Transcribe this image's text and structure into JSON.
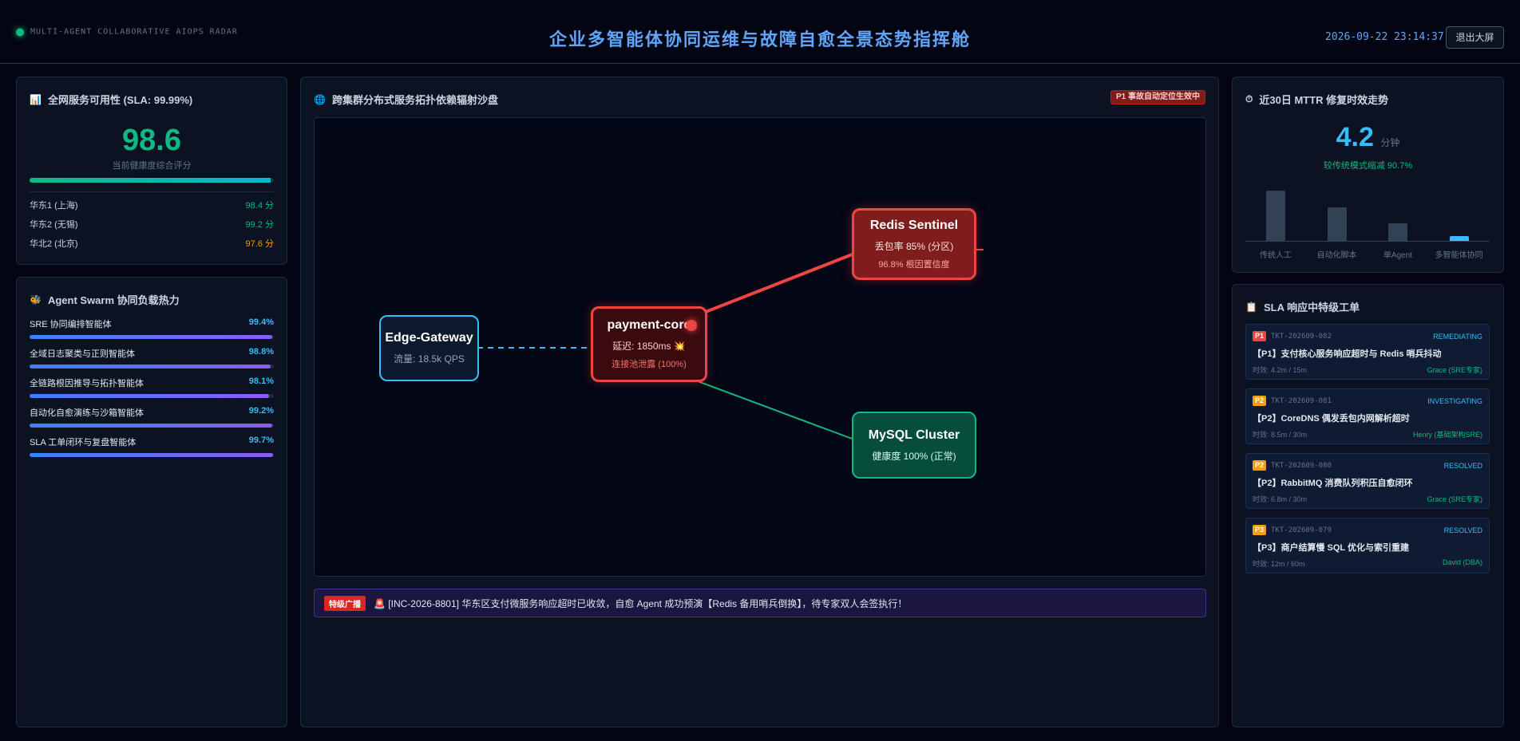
{
  "header": {
    "brand": "MULTI-AGENT COLLABORATIVE AIOPS RADAR",
    "title": "企业多智能体协同运维与故障自愈全景态势指挥舱",
    "datetime": "2026-09-22 23:14:37",
    "exit_label": "退出大屏"
  },
  "colors": {
    "accent": "#60a5fa",
    "healthy": "#10b981",
    "critical": "#ef4444",
    "warning": "#f59e0b",
    "background": "#030612"
  },
  "health": {
    "icon": "chart-icon",
    "title": "全网服务可用性 (SLA: 99.99%)",
    "score": "98.6",
    "score_label": "当前健康度综合评分",
    "progress": 0.986,
    "regions": [
      {
        "name": "华东1 (上海)",
        "value": "98.4 分",
        "color": "#10b981"
      },
      {
        "name": "华东2 (无锡)",
        "value": "99.2 分",
        "color": "#10b981"
      },
      {
        "name": "华北2 (北京)",
        "value": "97.6 分",
        "color": "#f59e0b"
      }
    ]
  },
  "agents": {
    "icon": "swarm-icon",
    "title": "Agent Swarm 协同负载热力",
    "items": [
      {
        "name": "SRE 协同编排智能体",
        "value": "99.4%",
        "fill": 0.994
      },
      {
        "name": "全域日志聚类与正则智能体",
        "value": "98.8%",
        "fill": 0.988
      },
      {
        "name": "全链路根因推导与拓扑智能体",
        "value": "98.1%",
        "fill": 0.981
      },
      {
        "name": "自动化自愈演练与沙箱智能体",
        "value": "99.2%",
        "fill": 0.992
      },
      {
        "name": "SLA 工单闭环与复盘智能体",
        "value": "99.7%",
        "fill": 0.997
      }
    ]
  },
  "topology": {
    "icon": "globe-icon",
    "title": "跨集群分布式服务拓扑依赖辐射沙盘",
    "badge": "P1 事故自动定位生效中",
    "nodes": {
      "gateway": {
        "name": "Edge-Gateway",
        "line1": "流量: 18.5k QPS"
      },
      "payment": {
        "name": "payment-core",
        "line1": "延迟: 1850ms 💥",
        "line2": "连接池泄露 (100%)"
      },
      "redis": {
        "name": "Redis Sentinel",
        "line1": "丢包率 85% (分区)",
        "line2": "96.8% 根因置信度"
      },
      "mysql": {
        "name": "MySQL Cluster",
        "line1": "健康度 100% (正常)"
      }
    },
    "broadcast": {
      "tag": "特级广播",
      "text": "🚨 [INC-2026-8801] 华东区支付微服务响应超时已收敛，自愈 Agent 成功预演【Redis 备用哨兵倒换】，待专家双人会签执行！"
    }
  },
  "mttr": {
    "icon": "stopwatch-icon",
    "title": "近30日 MTTR 修复时效走势",
    "value": "4.2",
    "unit": "分钟",
    "subtitle": "较传统模式缩减 90.7%",
    "chart_data": {
      "type": "bar",
      "categories": [
        "传统人工",
        "自动化脚本",
        "单Agent",
        "多智能体协同"
      ],
      "values": [
        45,
        30,
        16,
        4.2
      ],
      "ylim": [
        0,
        50
      ],
      "highlight_index": 3
    }
  },
  "tickets": {
    "icon": "clipboard-icon",
    "title": "SLA 响应中特级工单",
    "items": [
      {
        "priority": "P1",
        "color": "#ef4444",
        "id": "TKT-202609-082",
        "status": "REMEDIATING",
        "title": "【P1】支付核心服务响应超时与 Redis 哨兵抖动",
        "sla": "时效: 4.2m / 15m",
        "owner": "Grace (SRE专家)"
      },
      {
        "priority": "P2",
        "color": "#f59e0b",
        "id": "TKT-202609-081",
        "status": "INVESTIGATING",
        "title": "【P2】CoreDNS 偶发丢包内网解析超时",
        "sla": "时效: 8.5m / 30m",
        "owner": "Henry (基础架构SRE)"
      },
      {
        "priority": "P2",
        "color": "#f59e0b",
        "id": "TKT-202609-080",
        "status": "RESOLVED",
        "title": "【P2】RabbitMQ 消费队列积压自愈闭环",
        "sla": "时效: 6.8m / 30m",
        "owner": "Grace (SRE专家)"
      },
      {
        "priority": "P3",
        "color": "#f59e0b",
        "id": "TKT-202609-079",
        "status": "RESOLVED",
        "title": "【P3】商户结算慢 SQL 优化与索引重建",
        "sla": "时效: 12m / 60m",
        "owner": "David (DBA)"
      }
    ]
  }
}
